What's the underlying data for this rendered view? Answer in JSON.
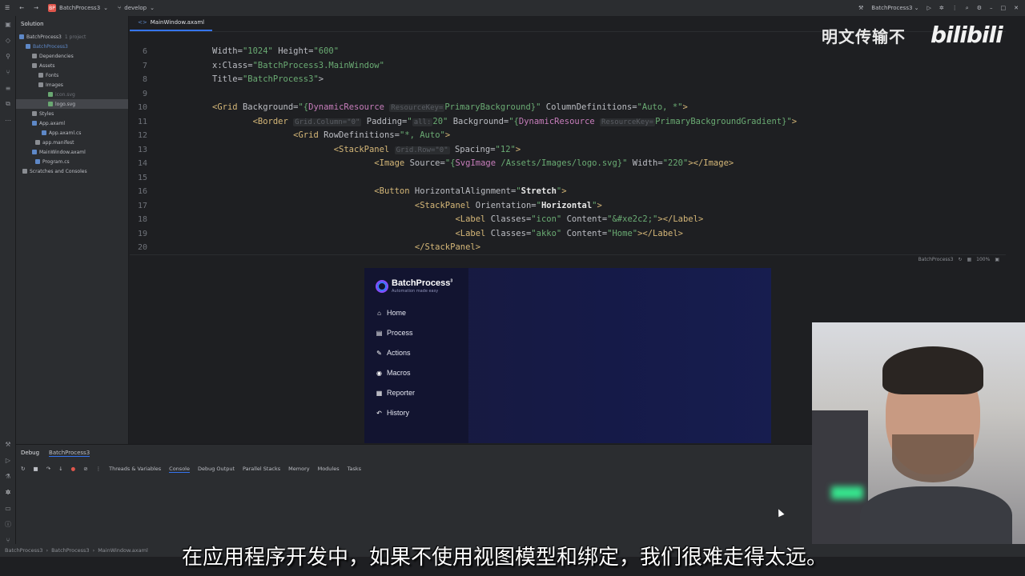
{
  "topbar": {
    "project": "BatchProcess3",
    "project_badge": "BP",
    "branch": "develop",
    "run_config": "BatchProcess3"
  },
  "solution": {
    "header": "Solution",
    "items": [
      {
        "label": "BatchProcess3",
        "extra": "1 project"
      },
      {
        "label": "BatchProcess3",
        "extra": ""
      },
      {
        "label": "Dependencies",
        "extra": ""
      },
      {
        "label": "Assets",
        "extra": ""
      },
      {
        "label": "Fonts",
        "extra": ""
      },
      {
        "label": "Images",
        "extra": ""
      },
      {
        "label": "icon.svg",
        "extra": ""
      },
      {
        "label": "logo.svg",
        "extra": ""
      },
      {
        "label": "Styles",
        "extra": ""
      },
      {
        "label": "App.axaml",
        "extra": ""
      },
      {
        "label": "App.axaml.cs",
        "extra": ""
      },
      {
        "label": "app.manifest",
        "extra": ""
      },
      {
        "label": "MainWindow.axaml",
        "extra": ""
      },
      {
        "label": "Program.cs",
        "extra": ""
      },
      {
        "label": "Scratches and Consoles",
        "extra": ""
      }
    ]
  },
  "editor": {
    "tab": "MainWindow.axaml",
    "lines": [
      {
        "n": "6"
      },
      {
        "n": "7"
      },
      {
        "n": "8"
      },
      {
        "n": "9"
      },
      {
        "n": "10"
      },
      {
        "n": "11"
      },
      {
        "n": "12"
      },
      {
        "n": "13"
      },
      {
        "n": "14"
      },
      {
        "n": "15"
      },
      {
        "n": "16"
      },
      {
        "n": "17"
      },
      {
        "n": "18"
      },
      {
        "n": "19"
      },
      {
        "n": "20"
      }
    ]
  },
  "preview_toolbar": {
    "config": "BatchProcess3",
    "zoom": "100%"
  },
  "app": {
    "logo_name": "BatchProcess",
    "logo_sup": "3",
    "logo_tagline": "Automation made easy",
    "nav": [
      {
        "icon": "home-icon",
        "glyph": "⌂",
        "label": "Home"
      },
      {
        "icon": "process-icon",
        "glyph": "▤",
        "label": "Process"
      },
      {
        "icon": "actions-icon",
        "glyph": "✎",
        "label": "Actions"
      },
      {
        "icon": "macros-icon",
        "glyph": "◉",
        "label": "Macros"
      },
      {
        "icon": "reporter-icon",
        "glyph": "▦",
        "label": "Reporter"
      },
      {
        "icon": "history-icon",
        "glyph": "↶",
        "label": "History"
      }
    ]
  },
  "debug": {
    "title": "Debug",
    "session": "BatchProcess3",
    "tabs": [
      "Threads & Variables",
      "Console",
      "Debug Output",
      "Parallel Stacks",
      "Memory",
      "Modules",
      "Tasks"
    ],
    "active_tab": "Console"
  },
  "statusbar": {
    "crumbs": [
      "BatchProcess3",
      "BatchProcess3",
      "MainWindow.axaml"
    ]
  },
  "overlay": {
    "watermark": "明文传输不",
    "bili_logo": "bilibili",
    "subtitle": "在应用程序开发中，如果不使用视图模型和绑定，我们很难走得太远。"
  }
}
